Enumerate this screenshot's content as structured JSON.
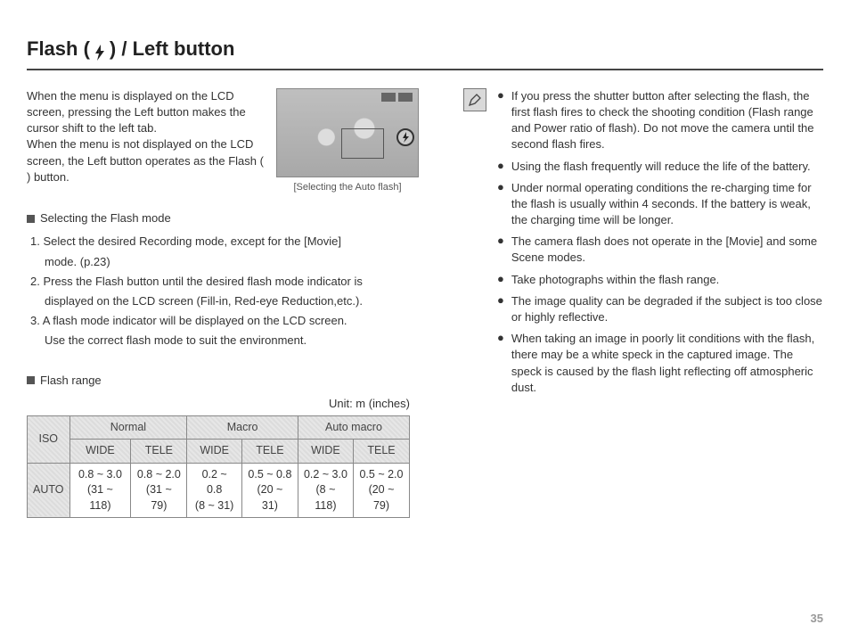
{
  "title_parts": {
    "a": "Flash (",
    "b": ") / Left button"
  },
  "intro": "When the menu is displayed on the LCD screen, pressing the Left button makes the cursor shift to the left tab.\nWhen the menu is not displayed on the LCD screen, the Left button operates as the Flash (      ) button.",
  "lcd_caption": "[Selecting the Auto flash]",
  "subhead_select": "Selecting the Flash mode",
  "steps": [
    "1. Select the desired Recording mode, except for the [Movie]",
    "mode. (p.23)",
    "2. Press the Flash button until the desired flash mode indicator is",
    "displayed on the LCD screen (Fill-in, Red-eye Reduction,etc.).",
    "3. A flash mode indicator will be displayed on the LCD screen.",
    "Use the correct flash mode to suit the environment."
  ],
  "subhead_range": "Flash range",
  "unit_label": "Unit: m (inches)",
  "table": {
    "iso": "ISO",
    "normal": "Normal",
    "macro": "Macro",
    "automacro": "Auto macro",
    "wide": "WIDE",
    "tele": "TELE",
    "row_label": "AUTO",
    "cells": [
      {
        "a": "0.8 ~ 3.0",
        "b": "(31 ~ 118)"
      },
      {
        "a": "0.8 ~ 2.0",
        "b": "(31 ~ 79)"
      },
      {
        "a": "0.2 ~ 0.8",
        "b": "(8 ~ 31)"
      },
      {
        "a": "0.5 ~ 0.8",
        "b": "(20 ~ 31)"
      },
      {
        "a": "0.2 ~ 3.0",
        "b": "(8 ~ 118)"
      },
      {
        "a": "0.5 ~ 2.0",
        "b": "(20 ~ 79)"
      }
    ]
  },
  "notes": [
    "If you press the shutter button after selecting the flash, the first flash fires to check the shooting condition (Flash range and Power ratio of flash). Do not move the camera until the second flash fires.",
    "Using the flash frequently will reduce the life of the battery.",
    "Under normal operating conditions the re-charging time for the flash is usually within 4 seconds. If the battery is weak, the charging time will be longer.",
    "The camera flash does not operate in the [Movie] and some Scene modes.",
    "Take photographs within the flash range.",
    "The image quality can be degraded if the subject is too close or highly reflective.",
    "When taking an image in poorly lit conditions with the flash, there may be a white speck in the captured image. The speck is caused by the flash light reflecting off atmospheric dust."
  ],
  "page_number": "35"
}
